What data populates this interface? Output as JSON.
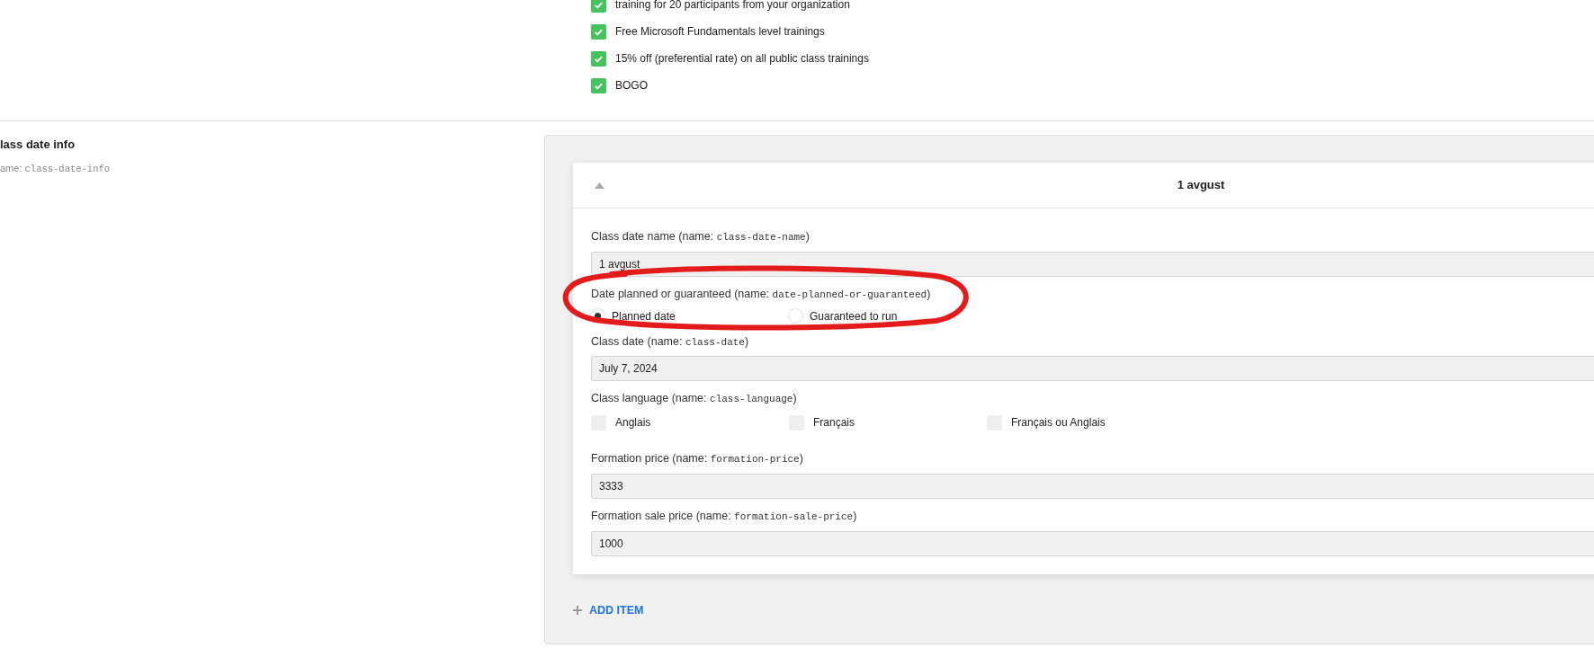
{
  "benefits": [
    {
      "text": "training for 20 participants from your organization",
      "checked": true
    },
    {
      "text": "Free Microsoft Fundamentals level trainings",
      "checked": true
    },
    {
      "text": "15% off (preferential rate) on all public class trainings",
      "checked": true
    },
    {
      "text": "BOGO",
      "checked": true
    }
  ],
  "section": {
    "title": "lass date info",
    "hint": "ame:",
    "code": "class-date-info"
  },
  "items": [
    {
      "title": "1 avgust",
      "expanded": true,
      "fields": [
        {
          "kind": "text",
          "label": "Class date name (name:",
          "code": "class-date-name",
          "close": ")",
          "value": "1 avgust"
        },
        {
          "kind": "radio",
          "label": "Date planned or guaranteed (name:",
          "code": "date-planned-or-guaranteed",
          "close": ")",
          "options": [
            {
              "label": "Planned date",
              "selected": true
            },
            {
              "label": "Guaranteed to run",
              "selected": false
            }
          ]
        },
        {
          "kind": "text",
          "label": "Class date (name:",
          "code": "class-date",
          "close": ")",
          "value": "July 7, 2024"
        },
        {
          "kind": "checkboxes",
          "label": "Class language (name:",
          "code": "class-language",
          "close": ")",
          "options": [
            {
              "label": "Anglais",
              "checked": false
            },
            {
              "label": "Français",
              "checked": false
            },
            {
              "label": "Français ou Anglais",
              "checked": false
            }
          ]
        },
        {
          "kind": "text",
          "label": "Formation price (name:",
          "code": "formation-price",
          "close": ")",
          "value": "3333"
        },
        {
          "kind": "text",
          "label": "Formation sale price (name:",
          "code": "formation-sale-price",
          "close": ")",
          "value": "1000"
        }
      ]
    }
  ],
  "add_button": "ADD ITEM"
}
